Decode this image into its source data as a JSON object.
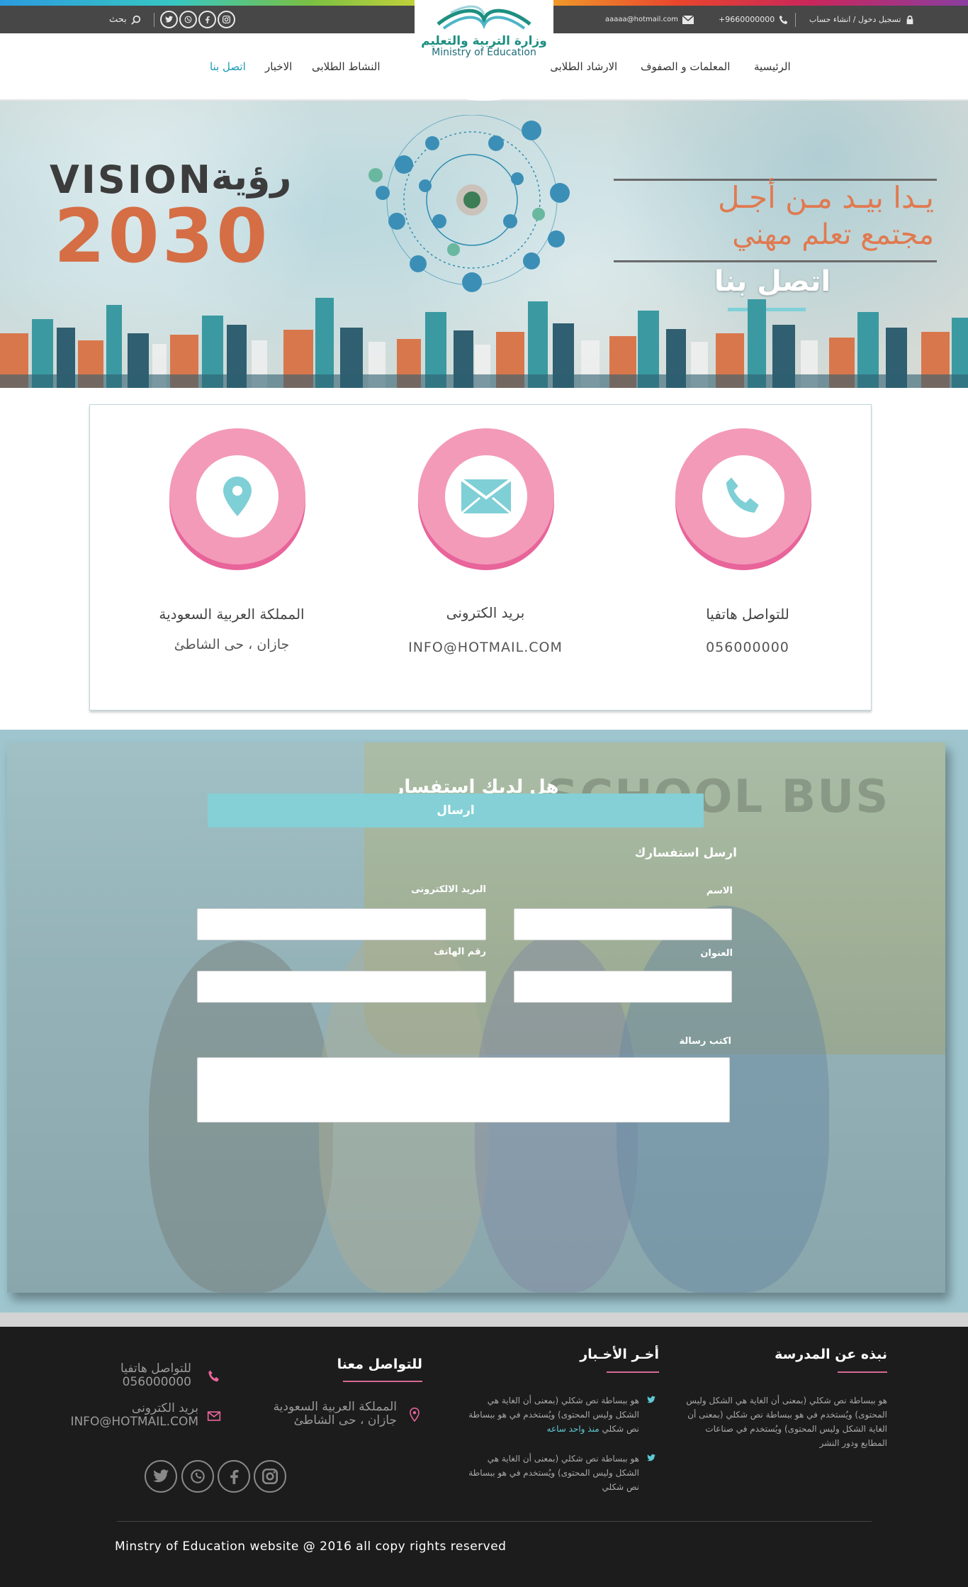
{
  "topbar": {
    "login_label": "تسجيل دخول / انشاء حساب",
    "phone": "+9660000000",
    "email": "aaaaa@hotmail.com",
    "search_label": "بحث",
    "icons": [
      "lock-icon",
      "phone-icon",
      "mail-icon",
      "search-icon",
      "twitter-icon",
      "whatsapp-icon",
      "facebook-icon",
      "instagram-icon"
    ]
  },
  "nav": {
    "items": [
      "الرئيسية",
      "المعلمات و الصفوف",
      "الارشاد الطلابى",
      "النشاط الطلابى",
      "الاخبار",
      "اتصل بنا"
    ],
    "active_index": 5,
    "logo_ar": "وزارة التربية والتعليم",
    "logo_en": "Ministry of Education"
  },
  "hero": {
    "vision_en": "VISION",
    "vision_ar": "رؤية",
    "year": "2030",
    "slogan_line1": "يـدا بيـد مـن أجـل",
    "slogan_line2": "مجتمع تعلم مهني",
    "title": "اتصل بنا"
  },
  "contact": {
    "items": [
      {
        "title": "للتواصل هاتفيا",
        "value": "056000000",
        "icon": "phone-icon"
      },
      {
        "title": "بريد الكترونى",
        "value": "INFO@HOTMAIL.COM",
        "icon": "mail-icon"
      },
      {
        "title": "المملكة العربية السعودية",
        "value": "جازان ، حى الشاطئ",
        "icon": "location-pin-icon"
      }
    ]
  },
  "inquiry": {
    "title": "هل لديك استفسار",
    "subtitle": "ارسل استفسارك",
    "labels": {
      "name": "الاسم",
      "email": "البريد الالكترونى",
      "address": "العنوان",
      "phone": "رقم الهاتف",
      "message": "اكتب رسالة"
    },
    "background_text": "SCHOOL BUS",
    "submit": "ارسال"
  },
  "footer": {
    "about_title": "نبذه عن المدرسة",
    "about_text": "هو ببساطة نص شكلي (بمعنى أن الغاية هي الشكل وليس المحتوى) ويُستخدم في هو ببساطة نص شكلي (بمعنى أن الغاية الشكل وليس المحتوى) ويُستخدم في صناعات المطابع ودور النشر",
    "news_title": "أخـر الأخـبار",
    "news": [
      {
        "text": "هو ببساطة نص شكلي (بمعنى أن الغاية هي الشكل وليس المحتوى) ويُستخدم في هو ببساطة نص شكلي",
        "time": "منذ واحد ساعه"
      },
      {
        "text": "هو ببساطة نص شكلي (بمعنى أن الغاية هي الشكل وليس المحتوى) ويُستخدم في هو ببساطة نص شكلي",
        "time": ""
      }
    ],
    "contact_title": "للتواصل معنا",
    "phone_label": "للتواصل هاتفيا",
    "phone_value": "056000000",
    "email_label": "بريد الكترونى",
    "email_value": "INFO@HOTMAIL.COM",
    "address_label": "المملكة العربية السعودية",
    "address_value": "جازان ، حى الشاطئ",
    "copyright": "Minstry of Education website @ 2016  all copy rights reserved"
  },
  "colors": {
    "accent": "#84d0d6",
    "pink": "#f39ab9",
    "pink_dark": "#e8649a",
    "topbar": "#474747",
    "footer": "#1c1c1c",
    "hero_orange": "#d56e45"
  }
}
